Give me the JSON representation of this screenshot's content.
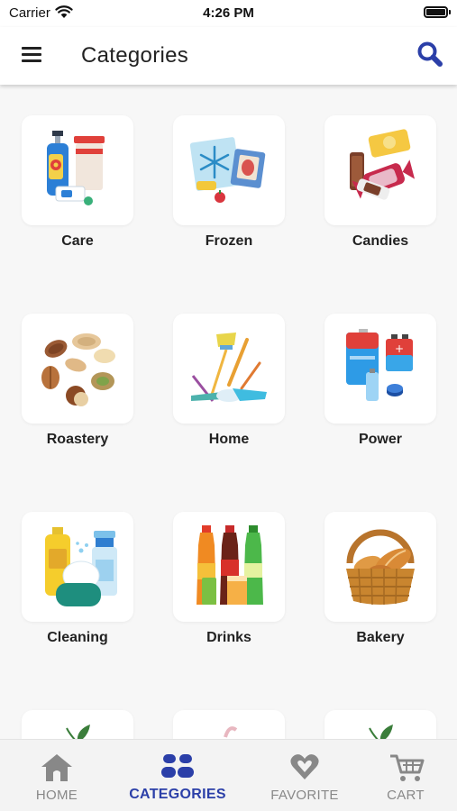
{
  "status_bar": {
    "carrier": "Carrier",
    "time": "4:26 PM"
  },
  "header": {
    "title": "Categories",
    "menu_icon": "hamburger-menu-icon",
    "search_icon": "search-icon"
  },
  "colors": {
    "accent": "#2b3fa8",
    "inactive": "#888888",
    "background": "#f7f7f7"
  },
  "categories": [
    {
      "label": "Care",
      "icon": "care-products-icon"
    },
    {
      "label": "Frozen",
      "icon": "frozen-food-icon"
    },
    {
      "label": "Candies",
      "icon": "candies-icon"
    },
    {
      "label": "Roastery",
      "icon": "nuts-icon"
    },
    {
      "label": "Home",
      "icon": "home-cleaning-tools-icon"
    },
    {
      "label": "Power",
      "icon": "batteries-icon"
    },
    {
      "label": "Cleaning",
      "icon": "cleaning-supplies-icon"
    },
    {
      "label": "Drinks",
      "icon": "drinks-bottles-icon"
    },
    {
      "label": "Bakery",
      "icon": "bread-basket-icon"
    }
  ],
  "tabs": [
    {
      "label": "HOME",
      "icon": "home-icon",
      "active": false
    },
    {
      "label": "CATEGORIES",
      "icon": "categories-icon",
      "active": true
    },
    {
      "label": "FAVORITE",
      "icon": "heart-icon",
      "active": false
    },
    {
      "label": "CART",
      "icon": "cart-icon",
      "active": false
    }
  ]
}
